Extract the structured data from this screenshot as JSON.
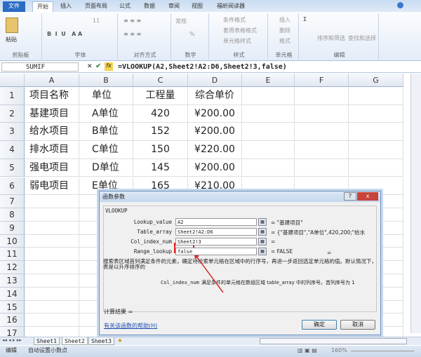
{
  "ribbon": {
    "tabs": [
      "文件",
      "开始",
      "插入",
      "页面布局",
      "公式",
      "数据",
      "审阅",
      "视图",
      "福昕阅读器"
    ],
    "active": "开始",
    "groups": {
      "clipboard": "剪贴板",
      "font": "字体",
      "align": "对齐方式",
      "number": "数字",
      "styles": "样式",
      "cells": "单元格",
      "editing": "编辑"
    },
    "paste": "粘贴",
    "font_size": "11",
    "number_format": "常规",
    "cond_format": "条件格式",
    "table_format": "套用表格格式",
    "cell_style": "单元格样式",
    "insert": "插入",
    "delete": "删除",
    "format": "格式",
    "sort_filter": "排序和筛选",
    "find_select": "查找和选择"
  },
  "formula_bar": {
    "name_box": "SUMIF",
    "formula": "=VLOOKUP(A2,Sheet2!A2:D6,Sheet2!3,false)"
  },
  "columns": [
    "A",
    "B",
    "C",
    "D",
    "E",
    "F",
    "G"
  ],
  "rows": [
    "1",
    "2",
    "3",
    "4",
    "5",
    "6",
    "7",
    "8",
    "9",
    "10",
    "11",
    "12",
    "13",
    "14",
    "15",
    "16",
    "17"
  ],
  "cells": [
    [
      "项目名称",
      "单位",
      "工程量",
      "综合单价"
    ],
    [
      "基建项目",
      "A单位",
      "420",
      "¥200.00"
    ],
    [
      "给水项目",
      "B单位",
      "152",
      "¥200.00"
    ],
    [
      "排水项目",
      "C单位",
      "150",
      "¥220.00"
    ],
    [
      "强电项目",
      "D单位",
      "145",
      "¥200.00"
    ],
    [
      "弱电项目",
      "E单位",
      "165",
      "¥210.00"
    ]
  ],
  "dialog": {
    "title": "函数参数",
    "function": "VLOOKUP",
    "args": [
      {
        "label": "Lookup_value",
        "value": "A2",
        "result": "= \"基建项目\""
      },
      {
        "label": "Table_array",
        "value": "Sheet2!A2:D6",
        "result": "= {\"基建项目\",\"A单位\",420,200;\"给水"
      },
      {
        "label": "Col_index_num",
        "value": "Sheet2!3",
        "result": "="
      },
      {
        "label": "Range_lookup",
        "value": "false",
        "result": "= FALSE"
      }
    ],
    "eq": "=",
    "description": "搜索表区域首列满足条件的元素，确定待检索单元格在区域中的行序号，再进一步返回选定单元格的值。默认情况下，表是以升序排序的",
    "arg_name": "Col_index_num",
    "arg_desc": "满足条件的单元格在数组区域 table_array 中的列序号。首列序号为 1",
    "calc_result": "计算结果 =",
    "help_link": "有关该函数的帮助(H)",
    "ok": "确定",
    "cancel": "取消",
    "help": "?",
    "close": "x"
  },
  "sheets": [
    "Sheet1",
    "Sheet2",
    "Sheet3"
  ],
  "status": {
    "mode": "编辑",
    "auto_decimal": "自动设置小数点",
    "zoom": "160%"
  },
  "colors": {
    "highlight": "#e02020",
    "file_tab": "#2b6cc4"
  }
}
